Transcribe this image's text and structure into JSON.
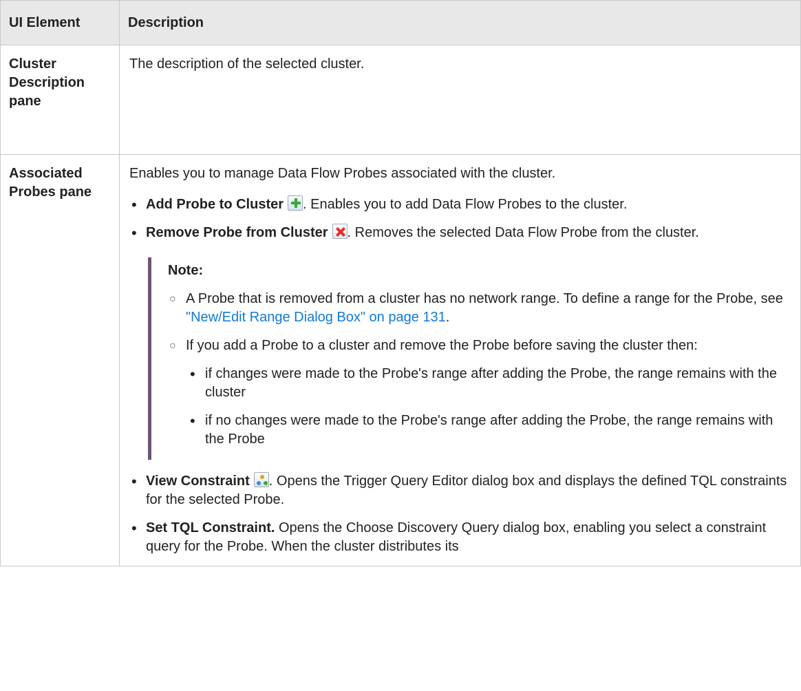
{
  "header": {
    "col1": "UI Element",
    "col2": "Description"
  },
  "rows": [
    {
      "element": "Cluster Description pane",
      "description": "The description of the selected cluster."
    },
    {
      "element": "Associated Probes pane",
      "intro": "Enables you to manage Data Flow Probes associated with the cluster.",
      "items": [
        {
          "label": "Add Probe to Cluster",
          "icon": "add-icon",
          "text": ". Enables you to add Data Flow Probes to the cluster."
        },
        {
          "label": "Remove Probe from Cluster",
          "icon": "remove-icon",
          "text": ". Removes the selected Data Flow Probe from the cluster."
        }
      ],
      "note": {
        "title": "Note:",
        "item1_text": "A Probe that is removed from a cluster has no network range. To define a range for the Probe, see ",
        "item1_link": "\"New/Edit Range Dialog Box\" on page 131",
        "item1_end": ".",
        "item2_text": "If you add a Probe to a cluster and remove the Probe before saving the cluster then:",
        "subitems": [
          "if changes were made to the Probe's range after adding the Probe, the range remains with the cluster",
          "if no changes were made to the Probe's range after adding the Probe, the range remains with the Probe"
        ]
      },
      "items_after": [
        {
          "label": "View Constraint",
          "icon": "view-constraint-icon",
          "text": ". Opens the Trigger Query Editor dialog box and displays the defined TQL constraints for the selected Probe."
        },
        {
          "label": "Set TQL Constraint.",
          "text": " Opens the Choose Discovery Query dialog box, enabling you select a constraint query for the Probe. When the cluster distributes its"
        }
      ]
    }
  ]
}
